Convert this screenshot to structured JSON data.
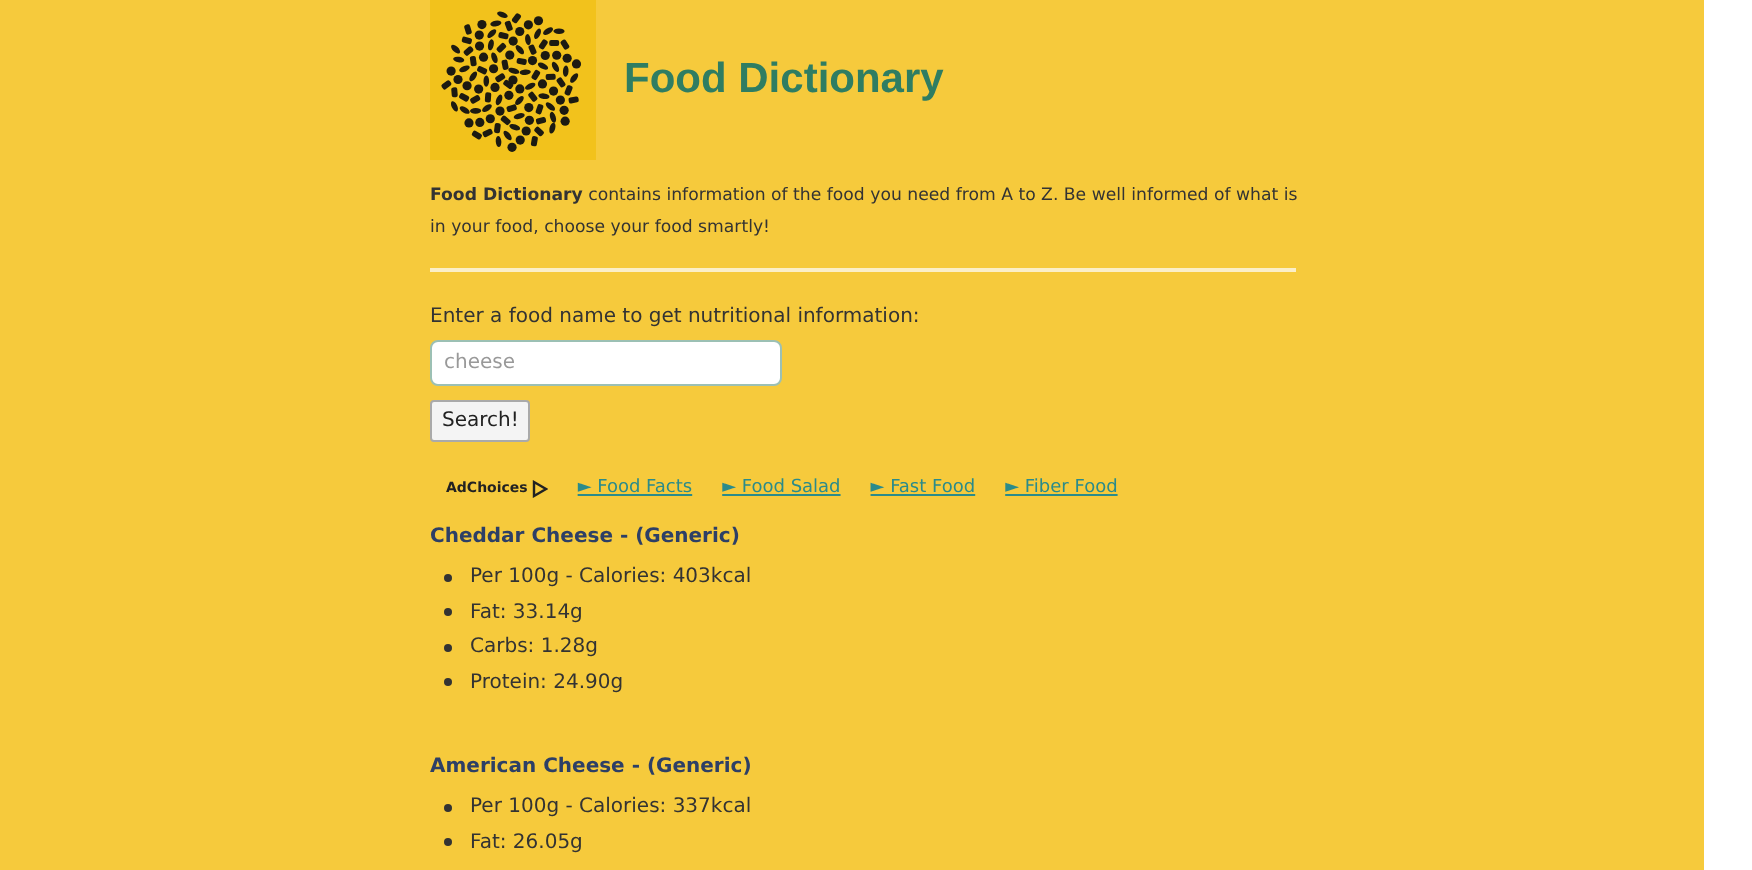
{
  "header": {
    "title": "Food Dictionary"
  },
  "intro": {
    "text": "**Food Dictionary** contains information of the food you need from A to Z. Be well informed of what is in your food, choose your food smartly!"
  },
  "search": {
    "label": "Enter a food name to get nutritional information:",
    "placeholder": "cheese",
    "button": "Search!"
  },
  "ads": {
    "label": "AdChoices",
    "links": [
      {
        "arrow": "►",
        "label": "Food Facts"
      },
      {
        "arrow": "►",
        "label": "Food Salad"
      },
      {
        "arrow": "►",
        "label": "Fast Food"
      },
      {
        "arrow": "►",
        "label": "Fiber Food"
      }
    ]
  },
  "results": [
    {
      "title": "Cheddar Cheese - (Generic)",
      "facts": [
        "Per 100g - Calories: 403kcal",
        "Fat: 33.14g",
        "Carbs: 1.28g",
        "Protein: 24.90g"
      ]
    },
    {
      "title": "American Cheese - (Generic)",
      "facts": [
        "Per 100g - Calories: 337kcal",
        "Fat: 26.05g"
      ]
    }
  ]
}
